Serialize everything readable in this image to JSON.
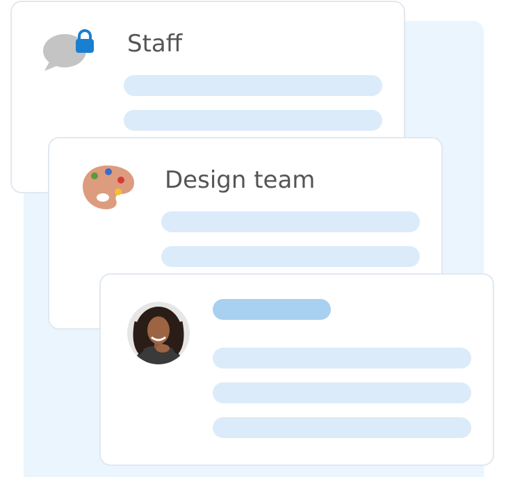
{
  "cards": [
    {
      "title": "Staff",
      "icon": "chat-lock-icon"
    },
    {
      "title": "Design team",
      "icon": "palette-icon"
    },
    {
      "title": "",
      "icon": "avatar-photo"
    }
  ],
  "colors": {
    "background_panel": "#eaf5fd",
    "card_border": "#e2e8f0",
    "placeholder_line": "#dbebfa",
    "placeholder_accent": "#a8d0f0",
    "lock": "#1a7fd0",
    "chat_bubble": "#c4c4c4",
    "palette": "#dd9c7e",
    "title_text": "#555555"
  }
}
